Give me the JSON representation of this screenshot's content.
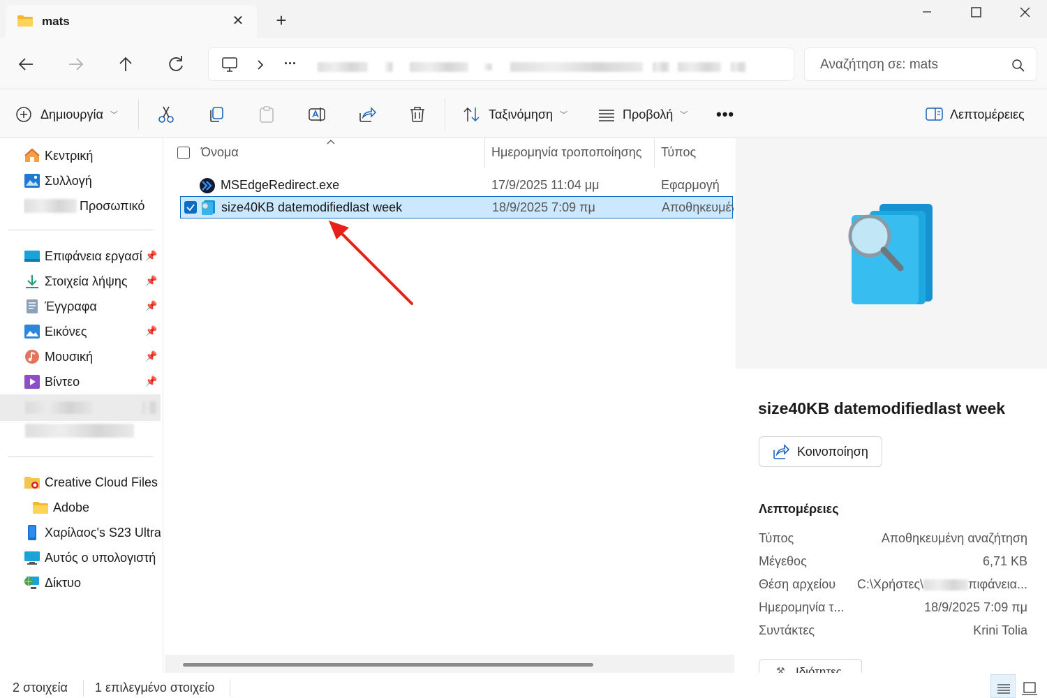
{
  "window": {
    "tab_title": "mats",
    "new_tab_label": "+",
    "close_tab_label": "✕"
  },
  "navigation": {
    "more_label": "···",
    "search_placeholder": "Αναζήτηση σε: mats"
  },
  "toolbar": {
    "new_label": "Δημιουργία",
    "sort_label": "Ταξινόμηση",
    "view_label": "Προβολή",
    "more_label": "•••",
    "details_label": "Λεπτομέρειες"
  },
  "sidebar": {
    "home": "Κεντρική",
    "gallery": "Συλλογή",
    "personal": "Προσωπικό",
    "quick_access": [
      {
        "label": "Επιφάνεια εργασί"
      },
      {
        "label": "Στοιχεία λήψης"
      },
      {
        "label": "Έγγραφα"
      },
      {
        "label": "Εικόνες"
      },
      {
        "label": "Μουσική"
      },
      {
        "label": "Βίντεο"
      }
    ],
    "locations": [
      {
        "label": "Creative Cloud Files F"
      },
      {
        "label": "Adobe"
      },
      {
        "label": "Χαρίλαος's S23 Ultra"
      },
      {
        "label": "Αυτός ο υπολογιστή"
      },
      {
        "label": "Δίκτυο"
      }
    ]
  },
  "file_list": {
    "columns": {
      "name": "Όνομα",
      "date": "Ημερομηνία τροποποίησης",
      "type": "Τύπος"
    },
    "rows": [
      {
        "name": "MSEdgeRedirect.exe",
        "date": "17/9/2025 11:04 μμ",
        "type": "Εφαρμογή"
      },
      {
        "name": "size40KB datemodifiedlast week",
        "date": "18/9/2025 7:09 πμ",
        "type": "Αποθηκευμένη"
      }
    ]
  },
  "details": {
    "title": "size40KB datemodifiedlast week",
    "share_label": "Κοινοποίηση",
    "section_title": "Λεπτομέρειες",
    "properties": [
      {
        "key": "Τύπος",
        "value": "Αποθηκευμένη αναζήτηση"
      },
      {
        "key": "Μέγεθος",
        "value": "6,71 KB"
      },
      {
        "key": "Θέση αρχείου",
        "value_prefix": "C:\\Χρήστες\\",
        "value_suffix": "πιφάνεια..."
      },
      {
        "key": "Ημερομηνία τ...",
        "value": "18/9/2025 7:09 πμ"
      },
      {
        "key": "Συντάκτες",
        "value": "Krini Tolia"
      }
    ],
    "properties_button": "Ιδιότητες"
  },
  "status": {
    "item_count": "2 στοιχεία",
    "selected_count": "1 επιλεγμένο στοιχείο"
  },
  "colors": {
    "accent": "#0b6cc0",
    "selection": "#cce8ff",
    "annotation_arrow": "#e8201a"
  }
}
